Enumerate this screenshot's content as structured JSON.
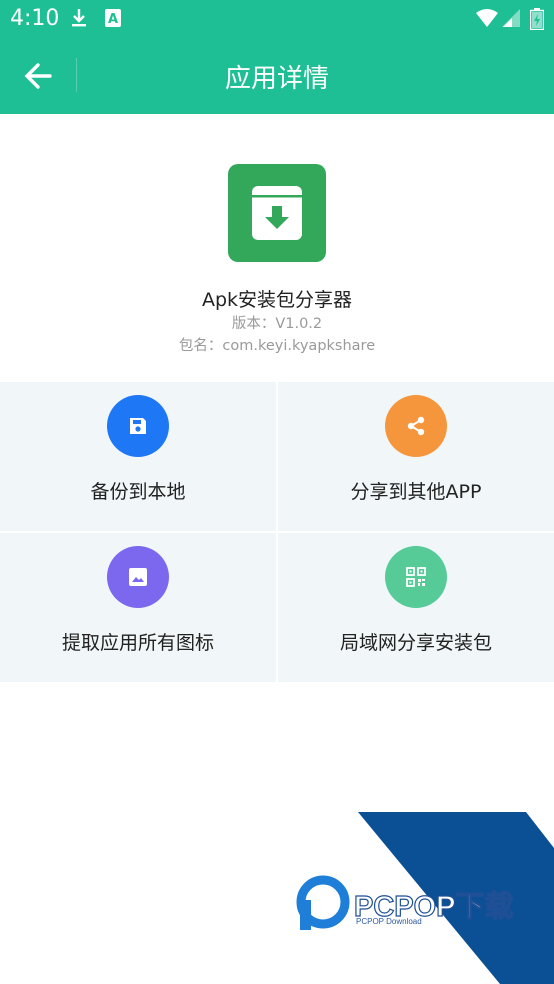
{
  "status_bar": {
    "time": "4:10",
    "icons": [
      "download-icon",
      "font-icon",
      "wifi-icon",
      "signal-icon",
      "battery-icon"
    ]
  },
  "app_bar": {
    "back_icon": "arrow-left-icon",
    "title": "应用详情"
  },
  "app_info": {
    "icon": "archive-download-icon",
    "name": "Apk安装包分享器",
    "version": "版本：V1.0.2",
    "package": "包名：com.keyi.kyapkshare"
  },
  "actions": [
    {
      "label": "备份到本地",
      "icon": "save-icon",
      "color": "#1e77f4"
    },
    {
      "label": "分享到其他APP",
      "icon": "share-icon",
      "color": "#f5963d"
    },
    {
      "label": "提取应用所有图标",
      "icon": "image-icon",
      "color": "#7b68ee"
    },
    {
      "label": "局域网分享安装包",
      "icon": "qrcode-icon",
      "color": "#56cb98"
    }
  ],
  "watermark": {
    "brand": "PCPOP下载",
    "subtitle": "PCPOP Download"
  },
  "colors": {
    "primary": "#1ebf94",
    "app_icon_bg": "#33a85a",
    "grid_bg": "#f1f6f9",
    "watermark_blue": "#0b4f95"
  }
}
